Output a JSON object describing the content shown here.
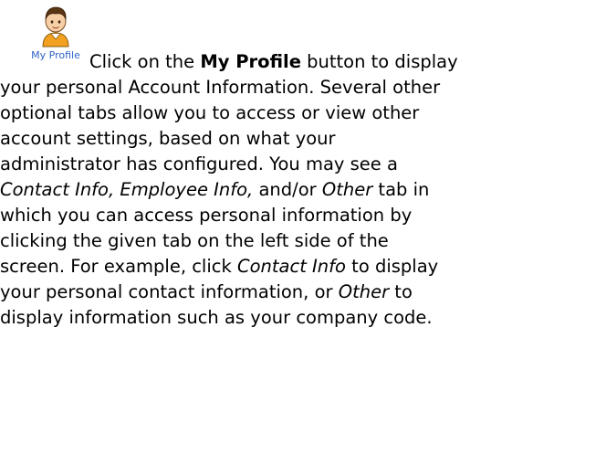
{
  "profile_button": {
    "label": "My Profile",
    "icon": "user-avatar-icon"
  },
  "text": {
    "l1_a": "Click on the ",
    "l1_b": "My Profile",
    "l1_c": " button to display",
    "l2": "your personal Account Information. Several other",
    "l3": "optional tabs allow you to access or view other",
    "l4": "account settings, based on what your",
    "l5": "administrator has configured.  You may see a",
    "l6_a": "Contact Info, Employee Info,",
    "l6_b": " and/or ",
    "l6_c": "Other",
    "l6_d": " tab in",
    "l7": "which you can access personal information by",
    "l8": "clicking the given tab on the left side of the",
    "l9_a": "screen. For example, click ",
    "l9_b": "Contact Info",
    "l9_c": " to display",
    "l10_a": "your personal contact information, or ",
    "l10_b": "Other",
    "l10_c": " to",
    "l11": "display information such as your company code."
  },
  "colors": {
    "caption": "#2f63c6",
    "text": "#000000"
  }
}
